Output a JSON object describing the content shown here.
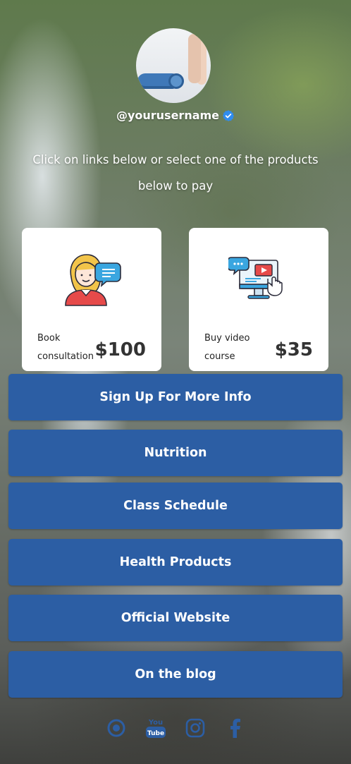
{
  "profile": {
    "username": "@yourusername",
    "verified_icon": "verified-badge-icon",
    "intro": "Click on links below or select one of the products below to pay"
  },
  "products": [
    {
      "label": "Book consultation",
      "price": "$100",
      "icon": "consultation-person-chat-icon"
    },
    {
      "label": "Buy video course",
      "price": "$35",
      "icon": "video-course-monitor-icon"
    }
  ],
  "links": [
    "Sign Up For More Info",
    "Nutrition",
    "Class Schedule",
    "Health Products",
    "Official Website",
    "On the blog"
  ],
  "socials": [
    {
      "name": "dot-circle-icon"
    },
    {
      "name": "youtube-icon",
      "text": "You Tube"
    },
    {
      "name": "instagram-icon"
    },
    {
      "name": "facebook-icon"
    }
  ],
  "colors": {
    "button": "#2c5ea4",
    "card": "#ffffff",
    "verified": "#2f8cf0",
    "social": "#2c5ea4"
  }
}
